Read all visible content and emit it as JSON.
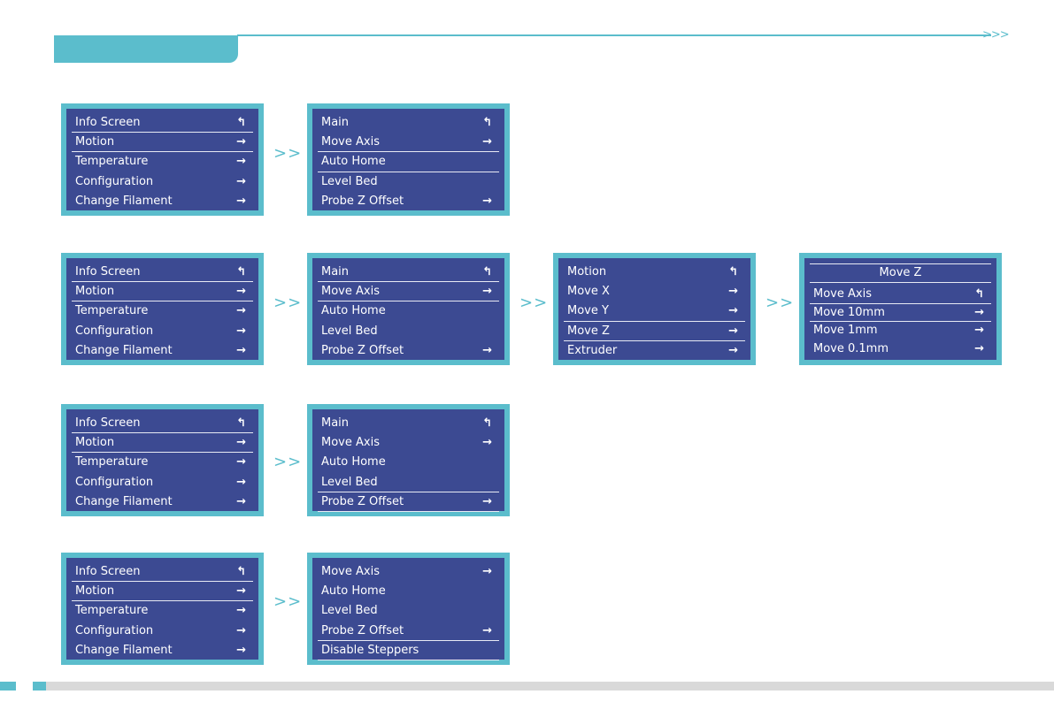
{
  "icons": {
    "back": "↰",
    "enter": "→"
  },
  "flow_arrow": ">>",
  "header_chevrons": ">>>",
  "main_menu": {
    "items": [
      "Info Screen",
      "Motion",
      "Temperature",
      "Configuration",
      "Change Filament"
    ]
  },
  "motion_menu": {
    "items_a": [
      "Main",
      "Move Axis",
      "Auto Home",
      "Level Bed",
      "Probe Z Offset"
    ],
    "items_b": [
      "Move Axis",
      "Auto Home",
      "Level Bed",
      "Probe Z Offset",
      "Disable Steppers"
    ]
  },
  "move_axis_menu": {
    "items": [
      "Motion",
      "Move X",
      "Move Y",
      "Move Z",
      "Extruder"
    ]
  },
  "move_z_menu": {
    "title": "Move Z",
    "items": [
      "Move Axis",
      "Move 10mm",
      "Move 1mm",
      "Move 0.1mm"
    ]
  },
  "colors": {
    "accent": "#5bbdcc",
    "screen_bg": "#3c4a92"
  }
}
